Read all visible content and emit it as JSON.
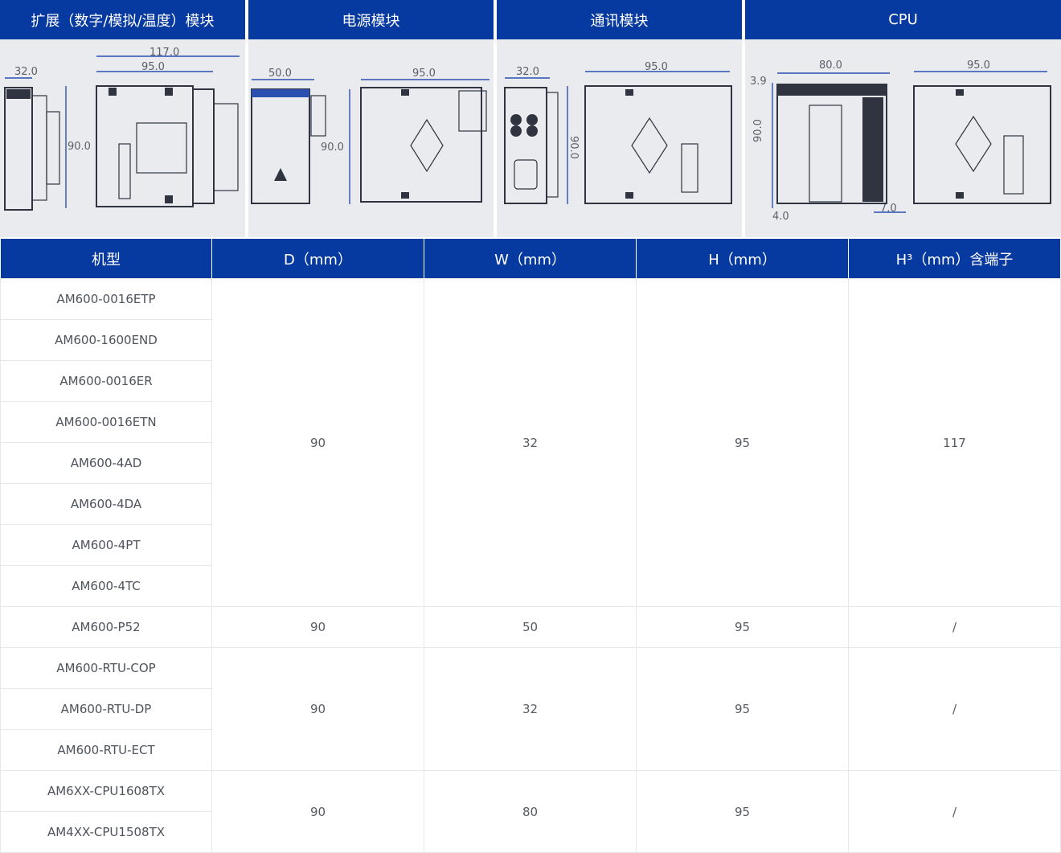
{
  "modules": [
    {
      "title": "扩展（数字/模拟/温度）模块",
      "dims": [
        "32.0",
        "117.0",
        "95.0",
        "90.0"
      ]
    },
    {
      "title": "电源模块",
      "dims": [
        "50.0",
        "95.0",
        "90.0"
      ]
    },
    {
      "title": "通讯模块",
      "dims": [
        "32.0",
        "95.0",
        "90.0"
      ]
    },
    {
      "title": "CPU",
      "dims": [
        "3.9",
        "80.0",
        "95.0",
        "90.0",
        "4.0",
        "7.0"
      ]
    }
  ],
  "table": {
    "headers": [
      "机型",
      "D（mm）",
      "W（mm）",
      "H（mm）",
      "H³（mm）含端子"
    ],
    "groups": [
      {
        "models": [
          "AM600-0016ETP",
          "AM600-1600END",
          "AM600-0016ER",
          "AM600-0016ETN",
          "AM600-4AD",
          "AM600-4DA",
          "AM600-4PT",
          "AM600-4TC"
        ],
        "d": "90",
        "w": "32",
        "h": "95",
        "h3": "117"
      },
      {
        "models": [
          "AM600-P52"
        ],
        "d": "90",
        "w": "50",
        "h": "95",
        "h3": "/"
      },
      {
        "models": [
          "AM600-RTU-COP",
          "AM600-RTU-DP",
          "AM600-RTU-ECT"
        ],
        "d": "90",
        "w": "32",
        "h": "95",
        "h3": "/"
      },
      {
        "models": [
          "AM6XX-CPU1608TX",
          "AM4XX-CPU1508TX"
        ],
        "d": "90",
        "w": "80",
        "h": "95",
        "h3": "/"
      }
    ]
  }
}
